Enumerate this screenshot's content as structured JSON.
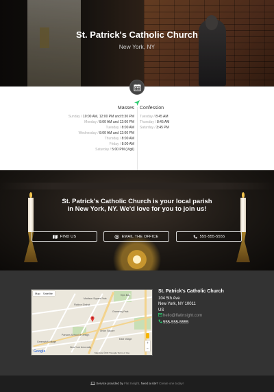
{
  "hero": {
    "title": "St. Patrick's Catholic Church",
    "subtitle": "New York, NY"
  },
  "schedule": {
    "masses_title": "Masses",
    "masses": [
      {
        "day": "Sunday /",
        "times": "10:00 AM, 12:00 PM and 5:30 PM"
      },
      {
        "day": "Monday /",
        "times": "8:00 AM and 12:00 PM"
      },
      {
        "day": "Tuesday /",
        "times": "8:00 AM"
      },
      {
        "day": "Wednesday /",
        "times": "8:00 AM and 12:00 PM"
      },
      {
        "day": "Thursday /",
        "times": "8:00 AM"
      },
      {
        "day": "Friday /",
        "times": "8:00 AM"
      },
      {
        "day": "Saturday /",
        "times": "5:00 PM (Vigil)"
      }
    ],
    "confession_title": "Confession",
    "confession": [
      {
        "day": "Tuesday /",
        "times": "8:45 AM"
      },
      {
        "day": "Thursday /",
        "times": "8:45 AM"
      },
      {
        "day": "Saturday /",
        "times": "3:45 PM"
      }
    ]
  },
  "banner": {
    "headline": "St. Patrick's Catholic Church is your local parish in New York, NY. We'd love for you to join us!",
    "buttons": {
      "find_us": "FIND US",
      "email": "EMAIL THE OFFICE",
      "phone": "555-555-5555"
    }
  },
  "map": {
    "type_map": "Map",
    "type_satellite": "Satellite",
    "labels": [
      "Kips Bay",
      "Flatiron District",
      "Gramercy Park",
      "Union Square",
      "East Village",
      "Greenwich Village",
      "New York University",
      "Parsons School of Design",
      "Madison Square Park"
    ],
    "google": "Google",
    "footer": "Map data ©2017 Google  Terms of Use"
  },
  "address": {
    "name": "St. Patrick's Catholic Church",
    "street": "104 5th Ave",
    "city": "New York, NY 10011",
    "country": "US",
    "email": "hello@flatinsight.com",
    "phone": "555-555-5555"
  },
  "footer": {
    "prefix": "Service provided by",
    "brand": "Flat Insight",
    "question": ". Need a site?",
    "cta": "Create one today!"
  },
  "colors": {
    "accent_green": "#2ecc71",
    "dark_bg": "#333333",
    "footer_bg": "#1e1e1e"
  }
}
